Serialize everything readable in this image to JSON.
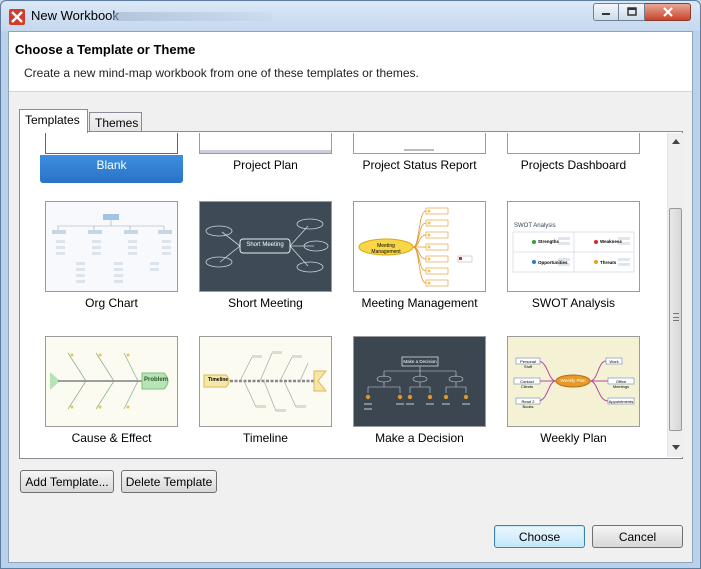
{
  "window": {
    "title": "New Workbook",
    "buttons": [
      "minimize",
      "maximize",
      "close"
    ]
  },
  "header": {
    "title": "Choose a Template or Theme",
    "description": "Create a new mind-map workbook from one of these templates or themes."
  },
  "tabs": [
    {
      "label": "Templates",
      "active": true
    },
    {
      "label": "Themes",
      "active": false
    }
  ],
  "templates": [
    {
      "name": "Blank",
      "selected": true
    },
    {
      "name": "Project Plan"
    },
    {
      "name": "Project Status Report"
    },
    {
      "name": "Projects Dashboard"
    },
    {
      "name": "Org Chart"
    },
    {
      "name": "Short Meeting"
    },
    {
      "name": "Meeting Management"
    },
    {
      "name": "SWOT Analysis"
    },
    {
      "name": "Cause & Effect"
    },
    {
      "name": "Timeline"
    },
    {
      "name": "Make a Decision"
    },
    {
      "name": "Weekly Plan"
    }
  ],
  "thumb_text": {
    "short_meeting_center": "Short Meeting",
    "meeting_center": "Meeting Management",
    "swot_title": "SWOT Analysis",
    "swot_strengths": "Strengths",
    "swot_weakness": "Weakness",
    "swot_opportunities": "Opportunities",
    "swot_threats": "Threats",
    "cause_problem": "Problem",
    "timeline_center": "Timeline",
    "decision_center": "Make a Decision",
    "weekly_center": "Weekly Plan",
    "weekly_personal": "Personal Stuff",
    "weekly_work": "Work",
    "weekly_contact": "Contact Clients",
    "weekly_meetings": "Office Meetings",
    "weekly_read": "Read 2 Books",
    "weekly_appointments": "Appointments"
  },
  "buttons": {
    "add_template": "Add Template...",
    "delete_template": "Delete Template",
    "choose": "Choose",
    "cancel": "Cancel"
  },
  "colors": {
    "selection": "#2a73c6",
    "default_button_border": "#3c7fb1",
    "close_button": "#c9452c"
  }
}
